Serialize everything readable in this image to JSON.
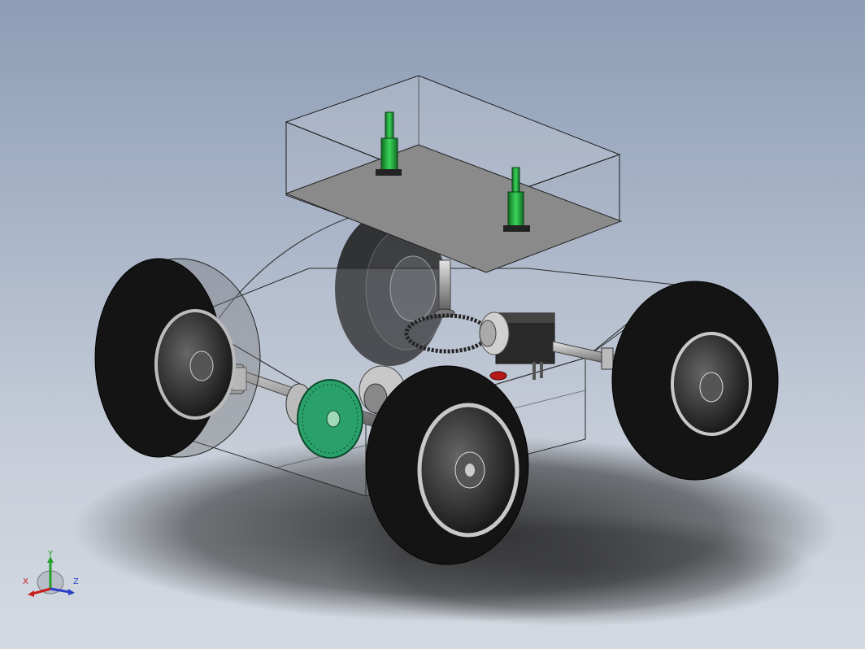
{
  "triad": {
    "x_label": "X",
    "y_label": "Y",
    "z_label": "Z",
    "colors": {
      "x": "#c81e1e",
      "y": "#22a02a",
      "z": "#2a3ec8"
    }
  },
  "colors": {
    "background_top": "#8d9db5",
    "background_bottom": "#d4d9e1",
    "tire": "#111111",
    "rim": "#c9c9c9",
    "gear": "#2aa06a",
    "actuator": "#1f9a34",
    "platform": "#8b8b8b",
    "shaft": "#b8b8b8"
  }
}
